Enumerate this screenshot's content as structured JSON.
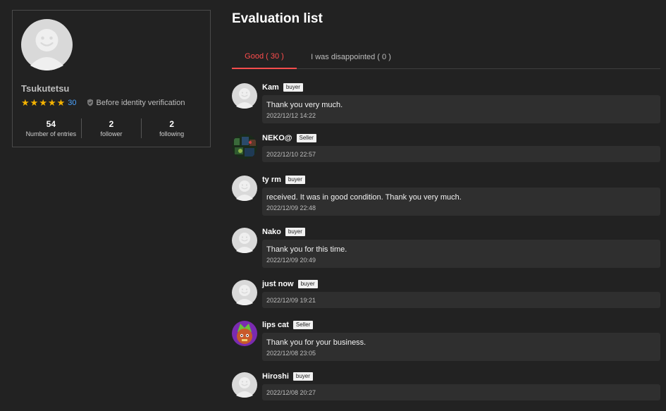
{
  "profile": {
    "username": "Tsukutetsu",
    "star_count": 5,
    "rating_count": "30",
    "verification": "Before identity verification",
    "stats": [
      {
        "value": "54",
        "label": "Number of entries"
      },
      {
        "value": "2",
        "label": "follower"
      },
      {
        "value": "2",
        "label": "following"
      }
    ]
  },
  "page_title": "Evaluation list",
  "tabs": {
    "good": "Good ( 30 )",
    "bad": "I was disappointed ( 0 )"
  },
  "reviews": [
    {
      "name": "Kam",
      "role": "buyer",
      "comment": "Thank you very much.",
      "date": "2022/12/12 14:22",
      "avatar": "default"
    },
    {
      "name": "NEKO@",
      "role": "Seller",
      "comment": "",
      "date": "2022/12/10 22:57",
      "avatar": "photo-dark"
    },
    {
      "name": "ty rm",
      "role": "buyer",
      "comment": "received. It was in good condition. Thank you very much.",
      "date": "2022/12/09 22:48",
      "avatar": "default"
    },
    {
      "name": "Nako",
      "role": "buyer",
      "comment": "Thank you for this time.",
      "date": "2022/12/09 20:49",
      "avatar": "default"
    },
    {
      "name": "just now",
      "role": "buyer",
      "comment": "",
      "date": "2022/12/09 19:21",
      "avatar": "default"
    },
    {
      "name": "lips cat",
      "role": "Seller",
      "comment": "Thank you for your business.",
      "date": "2022/12/08 23:05",
      "avatar": "photo-cat"
    },
    {
      "name": "Hiroshi",
      "role": "buyer",
      "comment": "",
      "date": "2022/12/08 20:27",
      "avatar": "default"
    }
  ],
  "colors": {
    "background": "#222222",
    "accent_tab": "#ff4d4d",
    "star": "#f5b301",
    "rating_link": "#4aa3ff",
    "review_box": "#2f2f2f"
  }
}
